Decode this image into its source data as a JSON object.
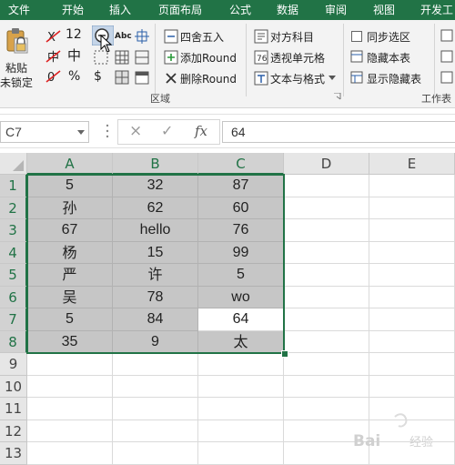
{
  "ribbon_tabs": [
    "文件",
    "开始",
    "插入",
    "页面布局",
    "公式",
    "数据",
    "审阅",
    "视图",
    "开发工"
  ],
  "ribbon": {
    "lock_button": {
      "line1": "粘贴",
      "line2": "未锁定"
    },
    "small_icons": {
      "r1": [
        "12",
        "Abc"
      ],
      "r2": [
        "中"
      ],
      "r3": [
        "%",
        "$"
      ]
    },
    "round_group": {
      "items": [
        "四舍五入",
        "添加Round",
        "删除Round"
      ],
      "label": "区域"
    },
    "text_group": {
      "items": [
        "对方科目",
        "透视单元格",
        "文本与格式"
      ]
    },
    "sheet_group": {
      "items": [
        "同步选区",
        "隐藏本表",
        "显示隐藏表"
      ],
      "label": "工作表"
    }
  },
  "formula_bar": {
    "name_box": "C7",
    "cancel_icon": "×",
    "enter_icon": "✓",
    "fx_label": "fx",
    "value": "64"
  },
  "sheet": {
    "columns": [
      "A",
      "B",
      "C",
      "D",
      "E"
    ],
    "rows": [
      "1",
      "2",
      "3",
      "4",
      "5",
      "6",
      "7",
      "8",
      "9",
      "10",
      "11",
      "12",
      "13"
    ],
    "cells": [
      [
        "5",
        "32",
        "87"
      ],
      [
        "孙",
        "62",
        "60"
      ],
      [
        "67",
        "hello",
        "76"
      ],
      [
        "杨",
        "15",
        "99"
      ],
      [
        "严",
        "许",
        "5"
      ],
      [
        "吴",
        "78",
        "wo"
      ],
      [
        "5",
        "84",
        "64"
      ],
      [
        "35",
        "9",
        "太"
      ]
    ],
    "selected_range": "A1:C8",
    "active_cell": "C7"
  },
  "colors": {
    "brand": "#217346",
    "selection_fill": "#c6c6c6"
  }
}
